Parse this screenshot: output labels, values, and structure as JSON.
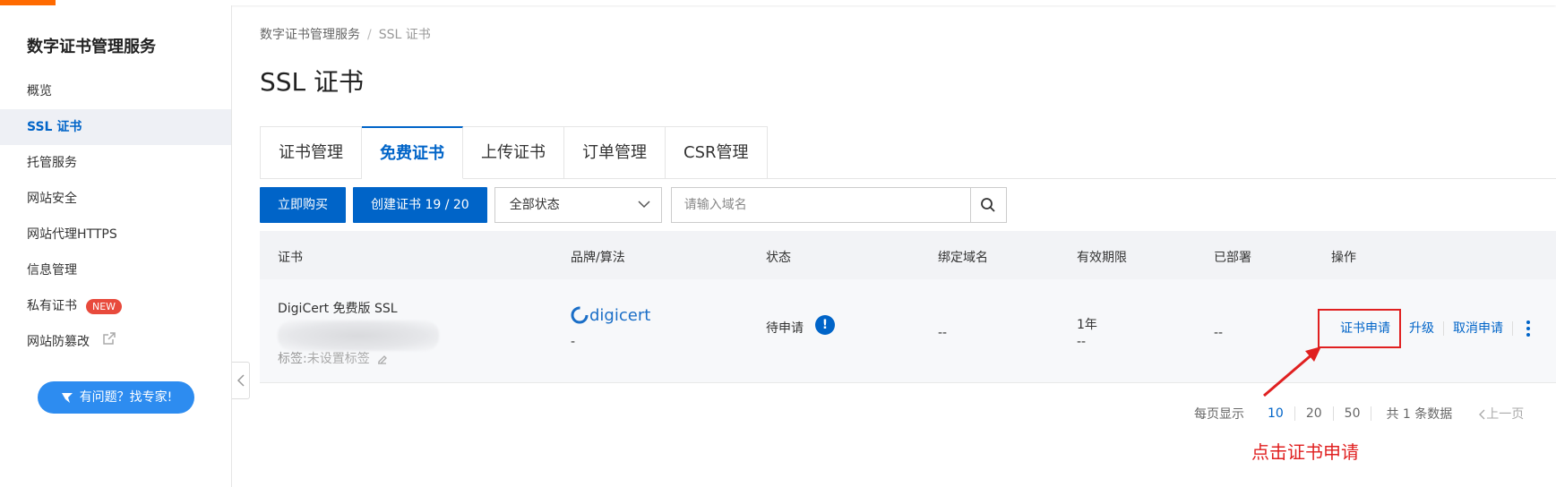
{
  "sidebar": {
    "title": "数字证书管理服务",
    "items": [
      {
        "label": "概览"
      },
      {
        "label": "SSL 证书"
      },
      {
        "label": "托管服务"
      },
      {
        "label": "网站安全"
      },
      {
        "label": "网站代理HTTPS"
      },
      {
        "label": "信息管理"
      },
      {
        "label": "私有证书",
        "badge": "NEW"
      },
      {
        "label": "网站防篡改",
        "icon": "external-link-icon"
      }
    ],
    "help_button": "有问题？找专家!"
  },
  "breadcrumb": {
    "root": "数字证书管理服务",
    "separator": "/",
    "current": "SSL 证书"
  },
  "page_title": "SSL 证书",
  "tabs": [
    {
      "label": "证书管理"
    },
    {
      "label": "免费证书"
    },
    {
      "label": "上传证书"
    },
    {
      "label": "订单管理"
    },
    {
      "label": "CSR管理"
    }
  ],
  "toolbar": {
    "buy_button": "立即购买",
    "create_button": "创建证书 19 / 20",
    "status_select": "全部状态",
    "search_placeholder": "请输入域名"
  },
  "table": {
    "headers": {
      "certificate": "证书",
      "brand": "品牌/算法",
      "status": "状态",
      "domain": "绑定域名",
      "validity": "有效期限",
      "deployed": "已部署",
      "actions": "操作"
    },
    "rows": [
      {
        "name": "DigiCert 免费版 SSL",
        "tag_label": "标签:",
        "tag_value": "未设置标签",
        "brand_logo": "digicert",
        "brand_sub": "-",
        "status": "待申请",
        "status_icon": "!",
        "domain": "--",
        "validity": "1年",
        "validity_sub": "--",
        "deployed": "--",
        "actions": [
          "证书申请",
          "升级",
          "取消申请"
        ]
      }
    ]
  },
  "pagination": {
    "per_page_label": "每页显示",
    "sizes": [
      "10",
      "20",
      "50"
    ],
    "active_size": "10",
    "total": "共 1 条数据",
    "prev": "上一页"
  },
  "annotation": {
    "text": "点击证书申请"
  },
  "colors": {
    "accent": "#0064c8",
    "brand_orange": "#ff6a00",
    "annotation_red": "#e02020",
    "badge_red": "#e84a3c"
  }
}
